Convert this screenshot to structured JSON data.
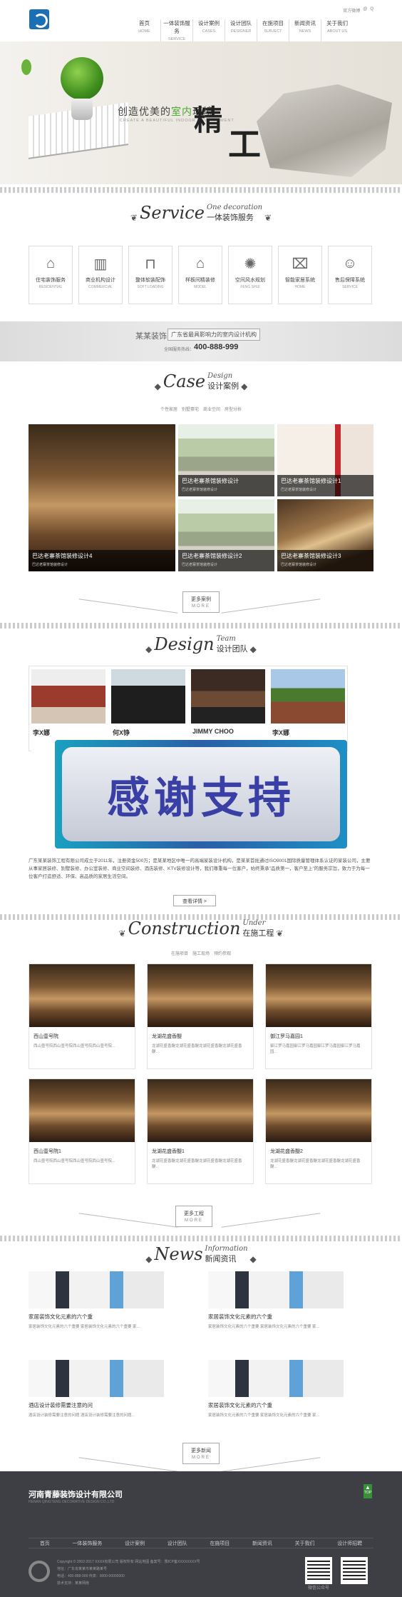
{
  "header": {
    "tools": [
      "官方微博",
      "@",
      "Q"
    ],
    "nav": [
      {
        "cn": "首页",
        "en": "HOME"
      },
      {
        "cn": "一体装饰服务",
        "en": "SERVICE"
      },
      {
        "cn": "设计案例",
        "en": "CASES"
      },
      {
        "cn": "设计团队",
        "en": "DESIGNER"
      },
      {
        "cn": "在施项目",
        "en": "SUBJECT"
      },
      {
        "cn": "新闻资讯",
        "en": "NEWS"
      },
      {
        "cn": "关于我们",
        "en": "ABOUT US"
      }
    ]
  },
  "banner": {
    "slogan_a": "创造优美的",
    "slogan_green": "室内",
    "slogan_b": "环境",
    "slogan_en": "CREATE A BEAUTIFUL INDOOR ENVIRONMENT",
    "big1": "精",
    "big2": "工"
  },
  "service": {
    "en": "Service",
    "italic": "One decoration",
    "cn": "一体装饰服务",
    "items": [
      {
        "cn": "住宅装饰服务",
        "en": "RESIDENTIAL",
        "icon": "house-icon"
      },
      {
        "cn": "商业机构设计",
        "en": "COMMERCIAL",
        "icon": "building-icon"
      },
      {
        "cn": "整体软装配饰",
        "en": "SOFT LOADING",
        "icon": "sofa-icon"
      },
      {
        "cn": "样板间精装修",
        "en": "MODEL",
        "icon": "model-room-icon"
      },
      {
        "cn": "空间风水规划",
        "en": "FENG SHUI",
        "icon": "compass-icon"
      },
      {
        "cn": "智能家居系统",
        "en": "HOME",
        "icon": "smart-home-icon"
      },
      {
        "cn": "售后保障系统",
        "en": "SERVICE",
        "icon": "worker-icon"
      }
    ]
  },
  "contact_bar": {
    "brand": "某某装饰",
    "tag": "广东省最具影响力的室内设计机构",
    "hotline_label": "全国服务热线：",
    "hotline": "400-888-999"
  },
  "cases": {
    "en": "Case",
    "italic": "Design",
    "cn": "设计案例",
    "tabs": [
      "个性家居",
      "别墅豪宅",
      "商业空间",
      "房型分析"
    ],
    "items": [
      {
        "title": "巴达老寨茶馆装修设计4",
        "sub": "巴达老寨茶馆装修设计"
      },
      {
        "title": "巴达老寨茶馆装修设计",
        "sub": "巴达老寨茶馆装修设计"
      },
      {
        "title": "巴达老寨茶馆装修设计1",
        "sub": "巴达老寨茶馆装修设计"
      },
      {
        "title": "巴达老寨茶馆装修设计2",
        "sub": "巴达老寨茶馆装修设计"
      },
      {
        "title": "巴达老寨茶馆装修设计3",
        "sub": "巴达老寨茶馆装修设计"
      }
    ],
    "more_cn": "更多案例",
    "more_en": "MORE"
  },
  "team": {
    "en": "Design",
    "italic": "Team",
    "cn": "设计团队",
    "members": [
      "李X娜",
      "何X铮",
      "JIMMY CHOO",
      "李X娜"
    ],
    "overlay": "感谢支持"
  },
  "intro": {
    "text": "广东某某装饰工程有限公司成立于2011年，注册资金500万；是某某地区中唯一的高端家装设计机构，是某某首批通过ISO9001国际质量管理体系认证的家装公司，主要从事家居装修、别墅装修、办公室装修、商业空间装修、酒店装修、KTV装修设计等，我们尊重每一位客户，始终秉承\"品质第一，客户至上\"的服务宗旨，致力于为每一位客户打造舒适、环保、高品质的家居生活空间。",
    "btn": "查看详情 >"
  },
  "construction": {
    "en": "Construction",
    "italic": "Under",
    "cn": "在施工程",
    "tabs": [
      "在施项目",
      "施工现场",
      "预约参观"
    ],
    "items": [
      {
        "title": "西山壹号院",
        "desc": "西山壹号院西山壹号院西山壹号院西山壹号院..."
      },
      {
        "title": "龙湖花盛香醍",
        "desc": "龙湖花盛香醍龙湖花盛香醍龙湖花盛香醍龙湖花盛香醍..."
      },
      {
        "title": "御江罗马嘉园1",
        "desc": "御江罗马嘉园御江罗马嘉园御江罗马嘉园御江罗马嘉园..."
      },
      {
        "title": "西山壹号院1",
        "desc": "西山壹号院西山壹号院西山壹号院西山壹号院..."
      },
      {
        "title": "龙湖花盛香醍1",
        "desc": "龙湖花盛香醍龙湖花盛香醍龙湖花盛香醍龙湖花盛香醍..."
      },
      {
        "title": "龙湖花盛香醍2",
        "desc": "龙湖花盛香醍龙湖花盛香醍龙湖花盛香醍龙湖花盛香醍..."
      }
    ],
    "more_cn": "更多工程",
    "more_en": "MORE"
  },
  "news": {
    "en": "News",
    "italic": "Information",
    "cn": "新闻资讯",
    "items": [
      {
        "title": "家居装饰文化元素的六个重",
        "desc": "家居装饰文化元素的六个重要 家居装饰文化元素的六个重要 家..."
      },
      {
        "title": "家居装饰文化元素的六个重",
        "desc": "家居装饰文化元素的六个重要 家居装饰文化元素的六个重要 家..."
      },
      {
        "title": "酒店设计装修需要注意的问",
        "desc": "酒店设计装修需要注意的问题 酒店设计装修需要注意的问题..."
      },
      {
        "title": "家居装饰文化元素的六个重",
        "desc": "家居装饰文化元素的六个重要 家居装饰文化元素的六个重要 家..."
      }
    ],
    "more_cn": "更多新闻",
    "more_en": "MORE"
  },
  "footer": {
    "company": "河南青藤装饰设计有限公司",
    "company_en": "HENAN QINGTENG DECORATIVE DESIGN CO.,LTD",
    "nav": [
      "首页",
      "一体装饰服务",
      "设计案例",
      "设计团队",
      "在施项目",
      "新闻资讯",
      "关于我们",
      "设计师招聘"
    ],
    "info": [
      "Copyright © 2002-2017 XXXX有限公司 版权所有  网站地图  备案号：豫ICP备XXXXXXXX号",
      "地址：广东省某某市某某路某号",
      "电话：400-888-999  传真：0000-00000000",
      "技术支持：某某网络"
    ],
    "top": "TOP",
    "wechat": "微信公众号"
  }
}
